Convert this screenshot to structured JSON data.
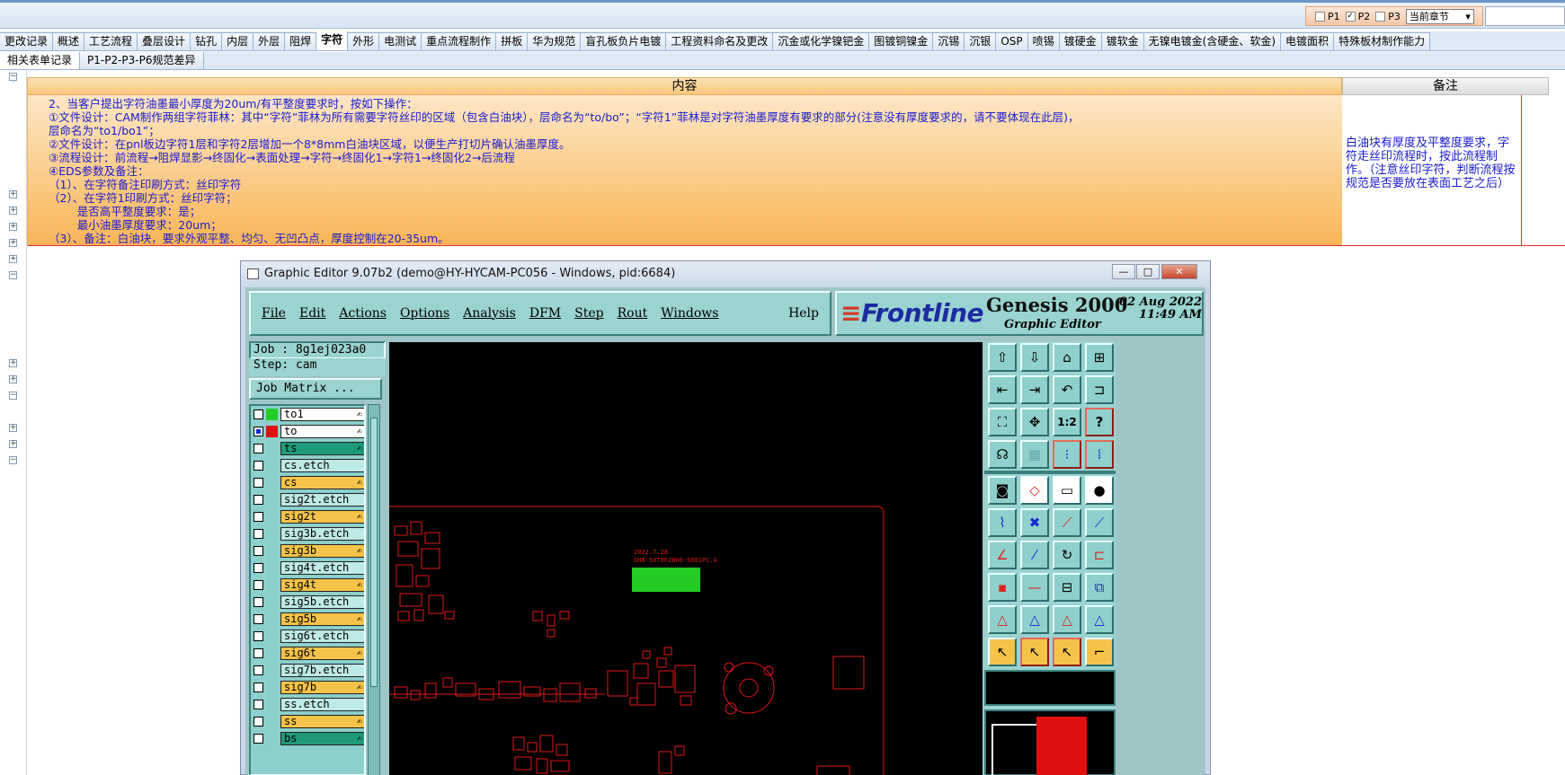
{
  "topbar": {
    "p_options": [
      {
        "label": "P1",
        "checked": false
      },
      {
        "label": "P2",
        "checked": true
      },
      {
        "label": "P3",
        "checked": false
      }
    ],
    "chapter_select": "当前章节"
  },
  "tabs_row1": [
    "更改记录",
    "概述",
    "工艺流程",
    "叠层设计",
    "钻孔",
    "内层",
    "外层",
    "阻焊",
    "字符",
    "外形",
    "电测试",
    "重点流程制作",
    "拼板",
    "华为规范",
    "盲孔板负片电镀",
    "工程资料命名及更改",
    "沉金或化学镍钯金",
    "图镀铜镍金",
    "沉锡",
    "沉银",
    "OSP",
    "喷锡",
    "镀硬金",
    "镀软金",
    "无镍电镀金(含硬金、软金)",
    "电镀面积",
    "特殊板材制作能力"
  ],
  "tabs_row1_active": "字符",
  "tabs_row2": [
    "相关表单记录",
    "P1-P2-P3-P6规范差异"
  ],
  "table": {
    "header_content": "内容",
    "header_note": "备注",
    "content_lines": [
      "2、当客户提出字符油墨最小厚度为20um/有平整度要求时，按如下操作：",
      "①文件设计：CAM制作两组字符菲林：其中“字符”菲林为所有需要字符丝印的区域（包含白油块），层命名为“to/bo”；“字符1”菲林是对字符油墨厚度有要求的部分(注意没有厚度要求的，请不要体现在此层)，",
      "层命名为“to1/bo1”；",
      "②文件设计：在pnl板边字符1层和字符2层增加一个8*8mm白油块区域，以便生产打切片确认油墨厚度。",
      "③流程设计：前流程→阻焊显影→终固化→表面处理→字符→终固化1→字符1→终固化2→后流程",
      "④EDS参数及备注：",
      "（1）、在字符备注印刷方式：丝印字符",
      "（2）、在字符1印刷方式：丝印字符；",
      "        是否高平整度要求：是；",
      "        最小油墨厚度要求：20um；",
      "（3）、备注：白油块，要求外观平整、均匀、无凹凸点，厚度控制在20-35um。"
    ],
    "note_text": "白油块有厚度及平整度要求，字符走丝印流程时，按此流程制作。（注意丝印字符，判断流程按规范是否要放在表面工艺之后）"
  },
  "graphic_editor": {
    "window_title": "Graphic Editor 9.07b2 (demo@HY-HYCAM-PC056 - Windows, pid:6684)",
    "menu": [
      "File",
      "Edit",
      "Actions",
      "Options",
      "Analysis",
      "DFM",
      "Step",
      "Rout",
      "Windows"
    ],
    "help": "Help",
    "brand_logo": "Frontline",
    "product": "Genesis 2000",
    "product_sub": "Graphic Editor",
    "date": "02 Aug 2022",
    "time": "11:49 AM",
    "job": "Job : 8g1ej023a0",
    "step": "Step: cam",
    "job_matrix": "Job Matrix ...",
    "layers": [
      {
        "name": "to1",
        "color": "#ffffff",
        "swatch": "#22cc22",
        "on": false
      },
      {
        "name": "to",
        "color": "#ffffff",
        "swatch": "#e01010",
        "on": true
      },
      {
        "name": "ts",
        "color": "#1e9a7a",
        "swatch": "",
        "on": false
      },
      {
        "name": "cs.etch",
        "color": "#bde9e6",
        "swatch": "",
        "on": false
      },
      {
        "name": "cs",
        "color": "#f6c34a",
        "swatch": "",
        "on": false
      },
      {
        "name": "sig2t.etch",
        "color": "#bde9e6",
        "swatch": "",
        "on": false
      },
      {
        "name": "sig2t",
        "color": "#f6c34a",
        "swatch": "",
        "on": false
      },
      {
        "name": "sig3b.etch",
        "color": "#bde9e6",
        "swatch": "",
        "on": false
      },
      {
        "name": "sig3b",
        "color": "#f6c34a",
        "swatch": "",
        "on": false
      },
      {
        "name": "sig4t.etch",
        "color": "#bde9e6",
        "swatch": "",
        "on": false
      },
      {
        "name": "sig4t",
        "color": "#f6c34a",
        "swatch": "",
        "on": false
      },
      {
        "name": "sig5b.etch",
        "color": "#bde9e6",
        "swatch": "",
        "on": false
      },
      {
        "name": "sig5b",
        "color": "#f6c34a",
        "swatch": "",
        "on": false
      },
      {
        "name": "sig6t.etch",
        "color": "#bde9e6",
        "swatch": "",
        "on": false
      },
      {
        "name": "sig6t",
        "color": "#f6c34a",
        "swatch": "",
        "on": false
      },
      {
        "name": "sig7b.etch",
        "color": "#bde9e6",
        "swatch": "",
        "on": false
      },
      {
        "name": "sig7b",
        "color": "#f6c34a",
        "swatch": "",
        "on": false
      },
      {
        "name": "ss.etch",
        "color": "#bde9e6",
        "swatch": "",
        "on": false
      },
      {
        "name": "ss",
        "color": "#f6c34a",
        "swatch": "",
        "on": false
      },
      {
        "name": "bs",
        "color": "#1e9a7a",
        "swatch": "",
        "on": false
      }
    ],
    "canvas_texts": [
      "2022.7.28",
      "DHB-50T0F2BH6-5001PC.A"
    ]
  }
}
